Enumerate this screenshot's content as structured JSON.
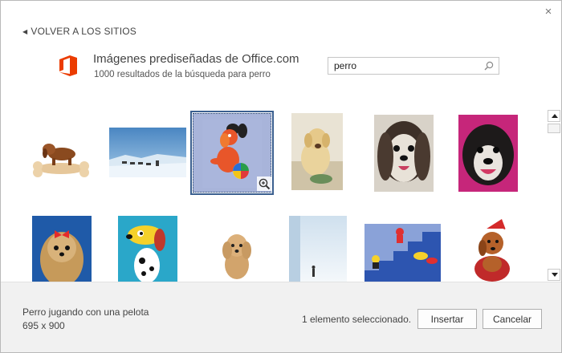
{
  "dialog": {
    "close_glyph": "×",
    "back_link": "VOLVER A LOS SITIOS",
    "back_arrow": "◀",
    "title": "Imágenes prediseñadas de Office.com",
    "subtitle": "1000 resultados de la búsqueda para perro",
    "logo_icon": "office-logo-icon",
    "brand_color": "#eb3c00",
    "selection_color": "#3a5f8f"
  },
  "search": {
    "value": "perro",
    "icon": "search-icon"
  },
  "results": {
    "items": [
      {
        "name": "result-dachshund-bone"
      },
      {
        "name": "result-sled-dogs"
      },
      {
        "name": "result-cartoon-dog-ball",
        "selected": true
      },
      {
        "name": "result-labrador-bowl"
      },
      {
        "name": "result-shih-tzu"
      },
      {
        "name": "result-black-white-dog"
      },
      {
        "name": "result-yorkshire-bow"
      },
      {
        "name": "result-cartoon-spotted-dog"
      },
      {
        "name": "result-poodle-sitting"
      },
      {
        "name": "result-dog-walking-snow"
      },
      {
        "name": "result-cartoon-dogs-stairs"
      },
      {
        "name": "result-dog-santa-hat"
      }
    ]
  },
  "footer": {
    "selected_name": "Perro jugando con una pelota",
    "selected_size": "695 x 900",
    "selection_count": "1 elemento seleccionado.",
    "insert_label": "Insertar",
    "cancel_label": "Cancelar"
  }
}
